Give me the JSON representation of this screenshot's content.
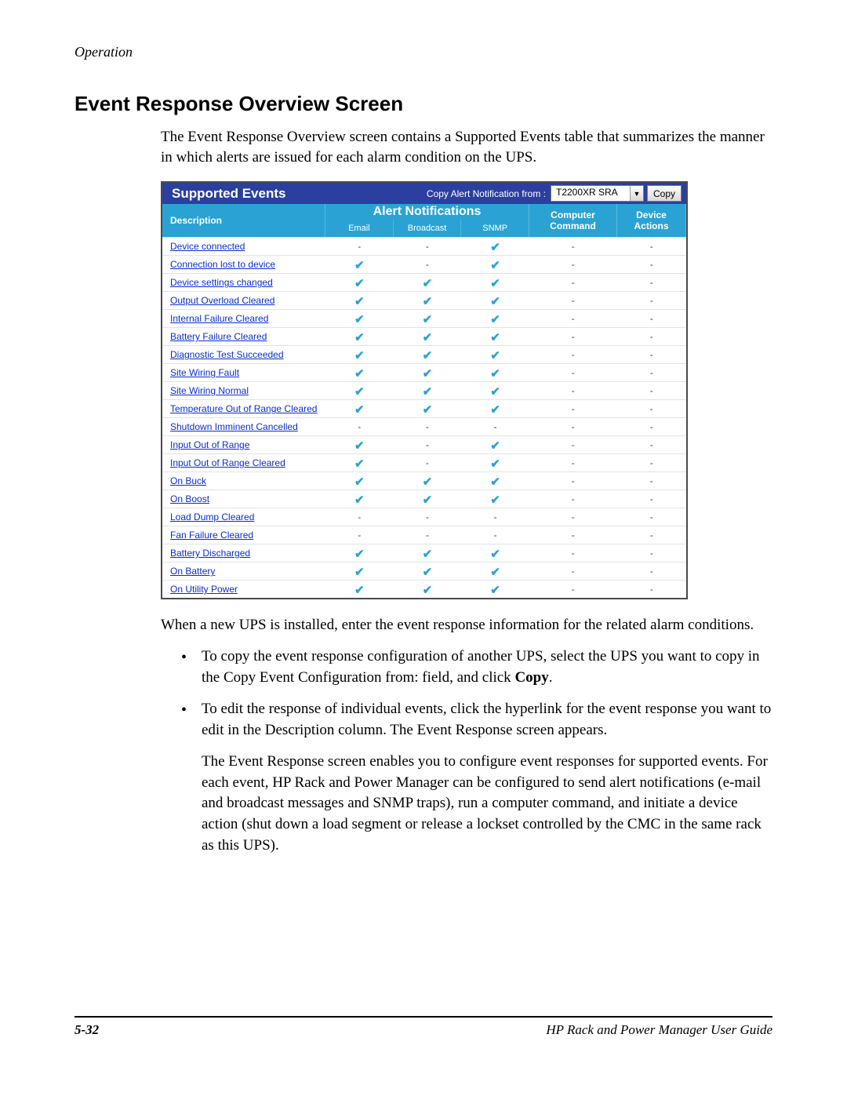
{
  "header": {
    "section": "Operation"
  },
  "title": "Event Response Overview Screen",
  "intro": "The Event Response Overview screen contains a Supported Events table that summarizes the manner in which alerts are issued for each alarm condition on the UPS.",
  "table": {
    "title": "Supported Events",
    "copy_label": "Copy Alert Notification from :",
    "dropdown_value": "T2200XR SRA",
    "copy_button": "Copy",
    "headers": {
      "description": "Description",
      "alerts_group": "Alert Notifications",
      "email": "Email",
      "broadcast": "Broadcast",
      "snmp": "SNMP",
      "computer_command_l1": "Computer",
      "computer_command_l2": "Command",
      "device_actions_l1": "Device",
      "device_actions_l2": "Actions"
    },
    "rows": [
      {
        "desc": "Device connected",
        "email": false,
        "broadcast": false,
        "snmp": true,
        "cmd": false,
        "act": false
      },
      {
        "desc": "Connection lost to device",
        "email": true,
        "broadcast": false,
        "snmp": true,
        "cmd": false,
        "act": false
      },
      {
        "desc": "Device settings changed",
        "email": true,
        "broadcast": true,
        "snmp": true,
        "cmd": false,
        "act": false
      },
      {
        "desc": "Output Overload Cleared",
        "email": true,
        "broadcast": true,
        "snmp": true,
        "cmd": false,
        "act": false
      },
      {
        "desc": "Internal Failure Cleared",
        "email": true,
        "broadcast": true,
        "snmp": true,
        "cmd": false,
        "act": false
      },
      {
        "desc": "Battery Failure Cleared",
        "email": true,
        "broadcast": true,
        "snmp": true,
        "cmd": false,
        "act": false
      },
      {
        "desc": "Diagnostic Test Succeeded",
        "email": true,
        "broadcast": true,
        "snmp": true,
        "cmd": false,
        "act": false
      },
      {
        "desc": "Site Wiring Fault",
        "email": true,
        "broadcast": true,
        "snmp": true,
        "cmd": false,
        "act": false
      },
      {
        "desc": "Site Wiring Normal",
        "email": true,
        "broadcast": true,
        "snmp": true,
        "cmd": false,
        "act": false
      },
      {
        "desc": "Temperature Out of Range Cleared",
        "email": true,
        "broadcast": true,
        "snmp": true,
        "cmd": false,
        "act": false
      },
      {
        "desc": "Shutdown Imminent Cancelled",
        "email": false,
        "broadcast": false,
        "snmp": false,
        "cmd": false,
        "act": false
      },
      {
        "desc": "Input Out of Range",
        "email": true,
        "broadcast": false,
        "snmp": true,
        "cmd": false,
        "act": false
      },
      {
        "desc": "Input Out of Range Cleared",
        "email": true,
        "broadcast": false,
        "snmp": true,
        "cmd": false,
        "act": false
      },
      {
        "desc": "On Buck",
        "email": true,
        "broadcast": true,
        "snmp": true,
        "cmd": false,
        "act": false
      },
      {
        "desc": "On Boost",
        "email": true,
        "broadcast": true,
        "snmp": true,
        "cmd": false,
        "act": false
      },
      {
        "desc": "Load Dump Cleared",
        "email": false,
        "broadcast": false,
        "snmp": false,
        "cmd": false,
        "act": false
      },
      {
        "desc": "Fan Failure Cleared",
        "email": false,
        "broadcast": false,
        "snmp": false,
        "cmd": false,
        "act": false
      },
      {
        "desc": "Battery Discharged",
        "email": true,
        "broadcast": true,
        "snmp": true,
        "cmd": false,
        "act": false
      },
      {
        "desc": "On Battery",
        "email": true,
        "broadcast": true,
        "snmp": true,
        "cmd": false,
        "act": false
      },
      {
        "desc": "On Utility Power",
        "email": true,
        "broadcast": true,
        "snmp": true,
        "cmd": false,
        "act": false
      }
    ]
  },
  "para_after": "When a new UPS is installed, enter the event response information for the related alarm conditions.",
  "bullets": [
    {
      "html": "To copy the event response configuration of another UPS, select the UPS you want to copy in the Copy Event Configuration from: field, and click <b>Copy</b>."
    },
    {
      "html": "To edit the response of individual events, click the hyperlink for the event response you want to edit in the Description column. The Event Response screen appears.",
      "sub": "The Event Response screen enables you to configure event responses for supported events. For each event, HP Rack and Power Manager can be configured to send alert notifications (e-mail and broadcast messages and SNMP traps), run a computer command, and initiate a device action (shut down a load segment or release a lockset controlled by the CMC in the same rack as this UPS)."
    }
  ],
  "footer": {
    "page": "5-32",
    "guide": "HP Rack and Power Manager User Guide"
  }
}
